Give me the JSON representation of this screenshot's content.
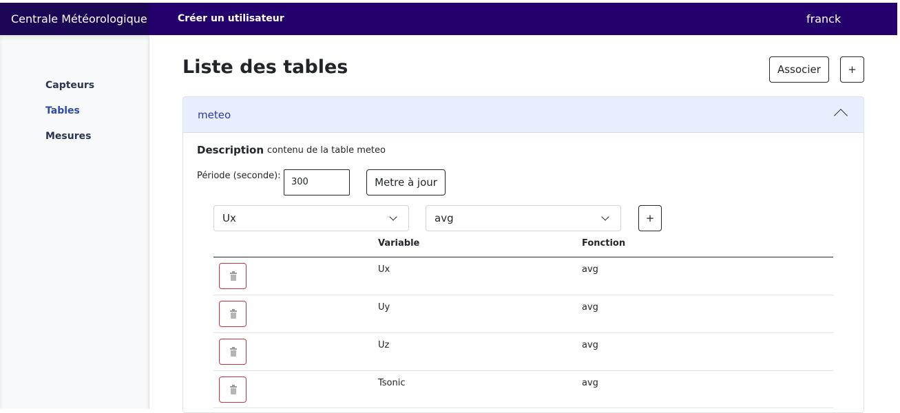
{
  "navbar": {
    "brand": "Centrale Météorologique",
    "create_user": "Créer un utilisateur",
    "user": "franck"
  },
  "sidebar": {
    "items": [
      {
        "label": "Capteurs"
      },
      {
        "label": "Tables"
      },
      {
        "label": "Mesures"
      }
    ],
    "active": "Tables"
  },
  "page": {
    "title": "Liste des tables",
    "associate_label": "Associer",
    "add_label": "+"
  },
  "table_panel": {
    "name": "meteo",
    "description_label": "Description",
    "description": "contenu de la table meteo",
    "period_label": "Période (seconde):",
    "period_value": "300",
    "update_label": "Metre à jour",
    "variable_select": "Ux",
    "function_select": "avg",
    "add_label": "+",
    "columns": {
      "variable": "Variable",
      "function": "Fonction"
    },
    "rows": [
      {
        "variable": "Ux",
        "function": "avg"
      },
      {
        "variable": "Uy",
        "function": "avg"
      },
      {
        "variable": "Uz",
        "function": "avg"
      },
      {
        "variable": "Tsonic",
        "function": "avg"
      }
    ]
  },
  "icons": {
    "delete": "trash-icon",
    "collapse": "chevron-up-icon",
    "dropdown": "chevron-down-icon"
  },
  "colors": {
    "navbar": "#23006b",
    "brand_bg": "#1c0656",
    "accordion_bg": "#e7eefe",
    "accordion_text": "#2c35b8",
    "delete_border": "#c9303d"
  }
}
